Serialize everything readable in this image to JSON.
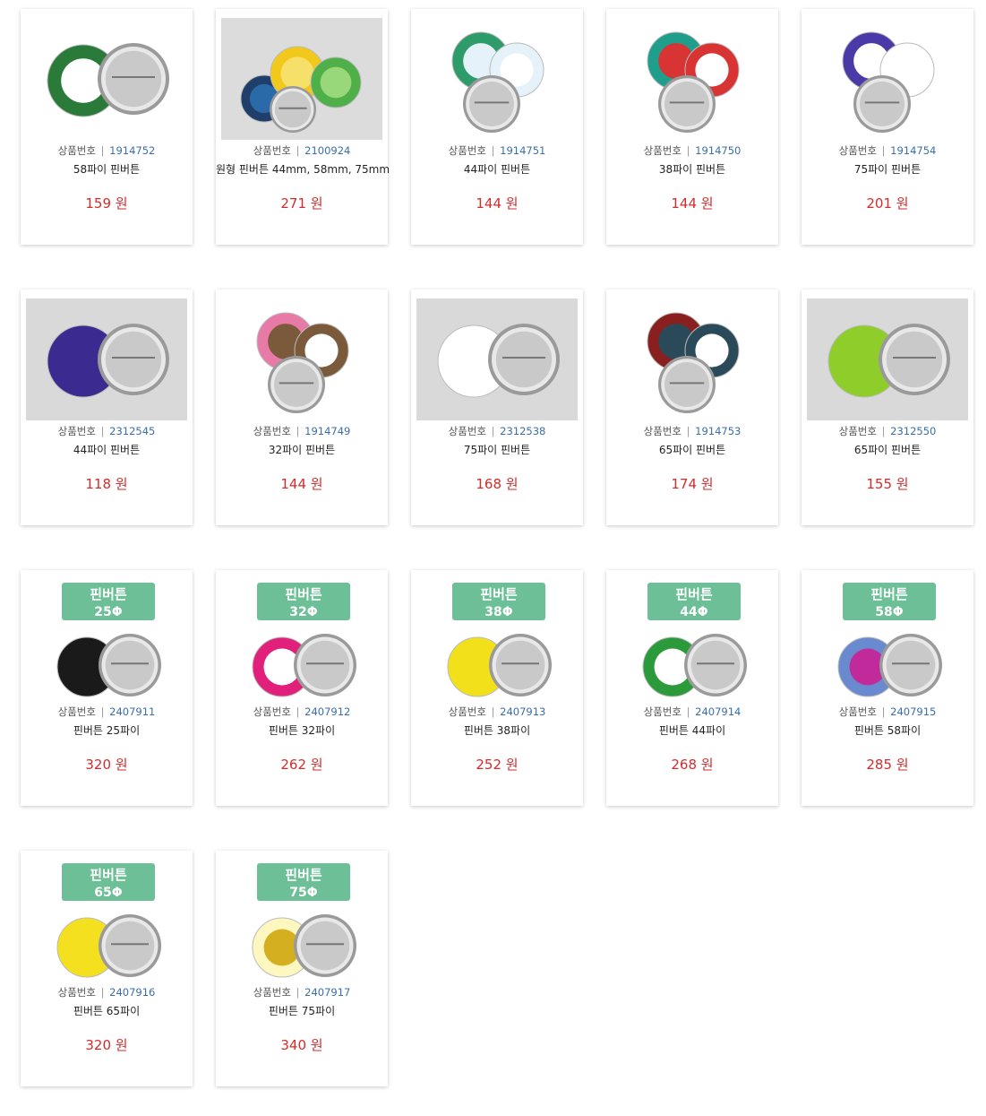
{
  "labels": {
    "code_label": "상품번호",
    "currency": "원"
  },
  "colors": {
    "price": "#d52b2b",
    "code": "#3b6ea8",
    "banner": "#6dbf98"
  },
  "products": [
    {
      "code": "1914752",
      "name": "58파이 핀버튼",
      "price": "159",
      "thumb": "pair",
      "art": {
        "bg": "#ffffff",
        "c1": "#2a7a3a",
        "c1b": "#ffffff",
        "c1r": 0.85,
        "text": "",
        "c2": "metal"
      }
    },
    {
      "code": "2100924",
      "name": "원형 핀버튼 44mm, 58mm, 75mm",
      "price": "271",
      "thumb": "photo",
      "art": {
        "bg": "#dcdcdc"
      }
    },
    {
      "code": "1914751",
      "name": "44파이 핀버튼",
      "price": "144",
      "thumb": "pair",
      "art": {
        "bg": "#ffffff",
        "c1": "#2e9c6a",
        "c1b": "#e6f2fa",
        "c2": "metal",
        "stack": true
      }
    },
    {
      "code": "1914750",
      "name": "38파이 핀버튼",
      "price": "144",
      "thumb": "pair",
      "art": {
        "bg": "#ffffff",
        "c1": "#1f9e8c",
        "c1b": "#d83434",
        "c2": "metal",
        "stack": true
      }
    },
    {
      "code": "1914754",
      "name": "75파이 핀버튼",
      "price": "201",
      "thumb": "pair",
      "art": {
        "bg": "#ffffff",
        "c1": "#4a3aa8",
        "c1b": "#ffffff",
        "c2": "metal",
        "stack": true
      }
    },
    {
      "code": "2312545",
      "name": "44파이 핀버튼",
      "price": "118",
      "thumb": "pair",
      "art": {
        "bg": "#d9d9d9",
        "c1": "#3b2a8f",
        "c2": "metal"
      }
    },
    {
      "code": "1914749",
      "name": "32파이 핀버튼",
      "price": "144",
      "thumb": "pair",
      "art": {
        "bg": "#ffffff",
        "c1": "#e87aa8",
        "c1b": "#7a5a3a",
        "c2": "metal",
        "stack": true
      }
    },
    {
      "code": "2312538",
      "name": "75파이 핀버튼",
      "price": "168",
      "thumb": "pair",
      "art": {
        "bg": "#d9d9d9",
        "c1": "#ffffff",
        "c2": "metal"
      }
    },
    {
      "code": "1914753",
      "name": "65파이 핀버튼",
      "price": "174",
      "thumb": "pair",
      "art": {
        "bg": "#ffffff",
        "c1": "#8a1f1f",
        "c1b": "#2a4a5a",
        "c2": "metal",
        "stack": true
      }
    },
    {
      "code": "2312550",
      "name": "65파이 핀버튼",
      "price": "155",
      "thumb": "pair",
      "art": {
        "bg": "#d9d9d9",
        "c1": "#8fce2a",
        "c2": "metal"
      }
    },
    {
      "code": "2407911",
      "name": "핀버튼 25파이",
      "price": "320",
      "thumb": "banner",
      "banner": [
        "핀버튼",
        "25Φ"
      ],
      "art": {
        "bg": "#ffffff",
        "c1": "#1a1a1a",
        "c2": "metal"
      }
    },
    {
      "code": "2407912",
      "name": "핀버튼 32파이",
      "price": "262",
      "thumb": "banner",
      "banner": [
        "핀버튼",
        "32Φ"
      ],
      "art": {
        "bg": "#ffffff",
        "c1": "#e0207a",
        "c1b": "#ffffff",
        "c2": "metal"
      }
    },
    {
      "code": "2407913",
      "name": "핀버튼 38파이",
      "price": "252",
      "thumb": "banner",
      "banner": [
        "핀버튼",
        "38Φ"
      ],
      "art": {
        "bg": "#ffffff",
        "c1": "#f2e01a",
        "c2": "metal"
      }
    },
    {
      "code": "2407914",
      "name": "핀버튼 44파이",
      "price": "268",
      "thumb": "banner",
      "banner": [
        "핀버튼",
        "44Φ"
      ],
      "art": {
        "bg": "#ffffff",
        "c1": "#2a9a3a",
        "c1b": "#ffffff",
        "c2": "metal"
      }
    },
    {
      "code": "2407915",
      "name": "핀버튼 58파이",
      "price": "285",
      "thumb": "banner",
      "banner": [
        "핀버튼",
        "58Φ"
      ],
      "art": {
        "bg": "#ffffff",
        "c1": "#6a8ad0",
        "c1b": "#c02a9a",
        "c2": "metal"
      }
    },
    {
      "code": "2407916",
      "name": "핀버튼 65파이",
      "price": "320",
      "thumb": "banner",
      "banner": [
        "핀버튼",
        "65Φ"
      ],
      "art": {
        "bg": "#ffffff",
        "c1": "#f5e020",
        "c2": "metal"
      }
    },
    {
      "code": "2407917",
      "name": "핀버튼 75파이",
      "price": "340",
      "thumb": "banner",
      "banner": [
        "핀버튼",
        "75Φ"
      ],
      "art": {
        "bg": "#ffffff",
        "c1": "#fff7c0",
        "c1b": "#d4b020",
        "c2": "metal"
      }
    }
  ]
}
